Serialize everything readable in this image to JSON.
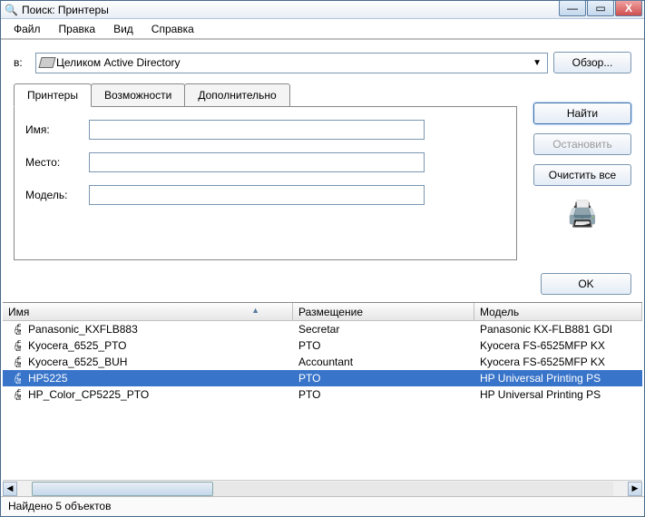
{
  "window": {
    "title": "Поиск: Принтеры"
  },
  "win_controls": {
    "minimize": "—",
    "maximize": "▭",
    "close": "X"
  },
  "menubar": [
    "Файл",
    "Правка",
    "Вид",
    "Справка"
  ],
  "scope": {
    "label": "в:",
    "value": "Целиком Active Directory",
    "browse": "Обзор..."
  },
  "tabs": [
    "Принтеры",
    "Возможности",
    "Дополнительно"
  ],
  "form": {
    "name_label": "Имя:",
    "name_value": "",
    "location_label": "Место:",
    "location_value": "",
    "model_label": "Модель:",
    "model_value": ""
  },
  "buttons": {
    "find": "Найти",
    "stop": "Остановить",
    "clear": "Очистить все",
    "ok": "OK"
  },
  "columns": {
    "name": "Имя",
    "location": "Размещение",
    "model": "Модель"
  },
  "rows": [
    {
      "name": "Panasonic_KXFLB883",
      "location": "Secretar",
      "model": "Panasonic KX-FLB881 GDI",
      "selected": false
    },
    {
      "name": "Kyocera_6525_PTO",
      "location": "PTO",
      "model": "Kyocera FS-6525MFP KX",
      "selected": false
    },
    {
      "name": "Kyocera_6525_BUH",
      "location": "Accountant",
      "model": "Kyocera FS-6525MFP KX",
      "selected": false
    },
    {
      "name": "HP5225",
      "location": "PTO",
      "model": "HP Universal Printing PS",
      "selected": true
    },
    {
      "name": "HP_Color_CP5225_PTO",
      "location": "PTO",
      "model": "HP Universal Printing PS",
      "selected": false
    }
  ],
  "status": "Найдено 5 объектов"
}
